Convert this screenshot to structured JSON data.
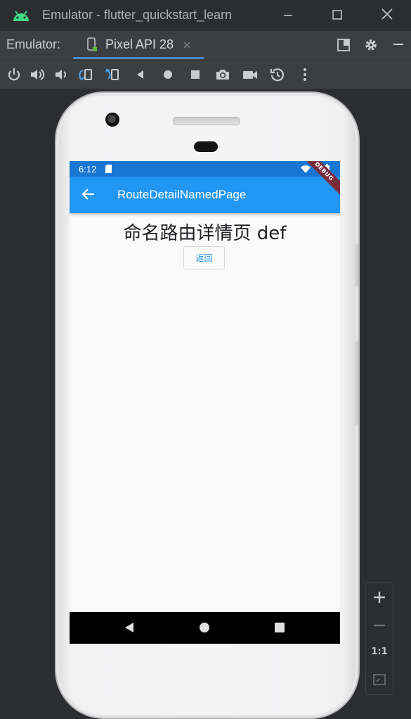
{
  "window": {
    "title": "Emulator - flutter_quickstart_learn"
  },
  "tabbar": {
    "label": "Emulator:",
    "tab_name": "Pixel API 28",
    "accent": "#4a88c7"
  },
  "toolbar": {
    "tools": [
      "power-icon",
      "volume-up-icon",
      "volume-down-icon",
      "rotate-left-icon",
      "rotate-right-icon",
      "back-icon",
      "home-icon",
      "overview-icon",
      "screenshot-icon",
      "screen-record-icon",
      "snapshot-icon",
      "more-icon"
    ]
  },
  "device": {
    "status": {
      "time": "6:12"
    },
    "appbar": {
      "title": "RouteDetailNamedPage",
      "color": "#2196f3",
      "status_color": "#1976d2"
    },
    "debug_banner": "DEBUG",
    "content": {
      "heading": "命名路由详情页 def",
      "back_button": "返回"
    }
  },
  "zoom": {
    "one_to_one": "1:1"
  }
}
